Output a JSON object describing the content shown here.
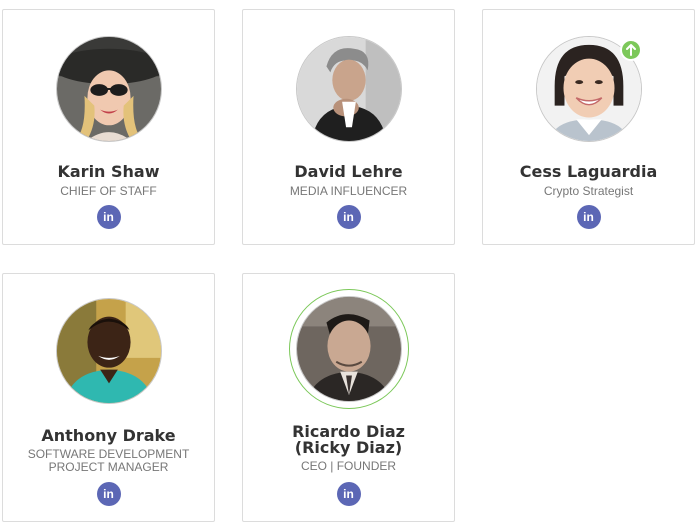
{
  "members": [
    {
      "name": "Karin Shaw",
      "role": "CHIEF OF STAFF",
      "social": "in",
      "social_icon": "linkedin-icon"
    },
    {
      "name": "David Lehre",
      "role": "MEDIA INFLUENCER",
      "social": "in",
      "social_icon": "linkedin-icon"
    },
    {
      "name": "Cess Laguardia",
      "role": "Crypto Strategist",
      "social": "in",
      "social_icon": "linkedin-icon",
      "badge_icon": "arrow-up-icon"
    },
    {
      "name": "Anthony Drake",
      "role": "SOFTWARE DEVELOPMENT PROJECT MANAGER",
      "social": "in",
      "social_icon": "linkedin-icon"
    },
    {
      "name": "Ricardo Diaz (Ricky Diaz)",
      "role": "CEO | FOUNDER",
      "social": "in",
      "social_icon": "linkedin-icon"
    }
  ],
  "colors": {
    "linkedin": "#5c67b5",
    "badge": "#7cc85a",
    "name": "#333333",
    "role": "#777777",
    "border": "#dcdcdc"
  }
}
